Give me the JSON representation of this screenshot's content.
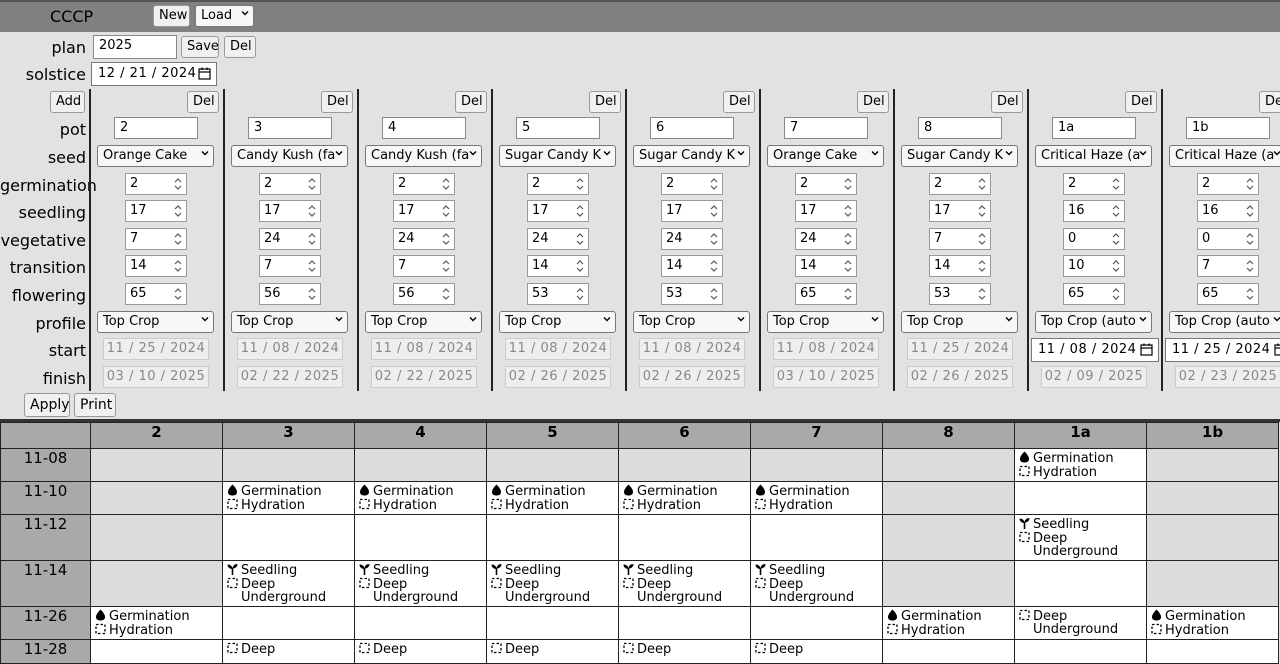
{
  "app": {
    "name": "CCCP",
    "new_label": "New",
    "load_label": "Load"
  },
  "plan": {
    "label": "plan",
    "value": "2025",
    "save_label": "Save",
    "del_label": "Del"
  },
  "solstice": {
    "label": "solstice",
    "value": "12 / 21 / 2024"
  },
  "add_label": "Add",
  "row_labels": {
    "pot": "pot",
    "seed": "seed",
    "germination": "germination",
    "seedling": "seedling",
    "vegetative": "vegetative",
    "transition": "transition",
    "flowering": "flowering",
    "profile": "profile",
    "start": "start",
    "finish": "finish"
  },
  "pots": [
    {
      "del": "Del",
      "pot": "2",
      "seed": "Orange Cake",
      "germination": "2",
      "seedling": "17",
      "vegetative": "7",
      "transition": "14",
      "flowering": "65",
      "profile": "Top Crop",
      "start": "11 / 25 / 2024",
      "finish": "03 / 10 / 2025"
    },
    {
      "del": "Del",
      "pot": "3",
      "seed": "Candy Kush (fa",
      "germination": "2",
      "seedling": "17",
      "vegetative": "24",
      "transition": "7",
      "flowering": "56",
      "profile": "Top Crop",
      "start": "11 / 08 / 2024",
      "finish": "02 / 22 / 2025"
    },
    {
      "del": "Del",
      "pot": "4",
      "seed": "Candy Kush (fa",
      "germination": "2",
      "seedling": "17",
      "vegetative": "24",
      "transition": "7",
      "flowering": "56",
      "profile": "Top Crop",
      "start": "11 / 08 / 2024",
      "finish": "02 / 22 / 2025"
    },
    {
      "del": "Del",
      "pot": "5",
      "seed": "Sugar Candy K",
      "germination": "2",
      "seedling": "17",
      "vegetative": "24",
      "transition": "14",
      "flowering": "53",
      "profile": "Top Crop",
      "start": "11 / 08 / 2024",
      "finish": "02 / 26 / 2025"
    },
    {
      "del": "Del",
      "pot": "6",
      "seed": "Sugar Candy K",
      "germination": "2",
      "seedling": "17",
      "vegetative": "24",
      "transition": "14",
      "flowering": "53",
      "profile": "Top Crop",
      "start": "11 / 08 / 2024",
      "finish": "02 / 26 / 2025"
    },
    {
      "del": "Del",
      "pot": "7",
      "seed": "Orange Cake",
      "germination": "2",
      "seedling": "17",
      "vegetative": "24",
      "transition": "14",
      "flowering": "65",
      "profile": "Top Crop",
      "start": "11 / 08 / 2024",
      "finish": "03 / 10 / 2025"
    },
    {
      "del": "Del",
      "pot": "8",
      "seed": "Sugar Candy K",
      "germination": "2",
      "seedling": "17",
      "vegetative": "7",
      "transition": "14",
      "flowering": "53",
      "profile": "Top Crop",
      "start": "11 / 25 / 2024",
      "finish": "02 / 26 / 2025"
    },
    {
      "del": "Del",
      "pot": "1a",
      "seed": "Critical Haze (a",
      "germination": "2",
      "seedling": "16",
      "vegetative": "0",
      "transition": "10",
      "flowering": "65",
      "profile": "Top Crop (auto",
      "start": "11 / 08 / 2024",
      "finish": "02 / 09 / 2025"
    },
    {
      "del": "Del",
      "pot": "1b",
      "seed": "Critical Haze (a",
      "germination": "2",
      "seedling": "16",
      "vegetative": "0",
      "transition": "7",
      "flowering": "65",
      "profile": "Top Crop (auto",
      "start": "11 / 25 / 2024",
      "finish": "02 / 23 / 2025"
    }
  ],
  "apply_label": "Apply",
  "print_label": "Print",
  "grid": {
    "columns": [
      "2",
      "3",
      "4",
      "5",
      "6",
      "7",
      "8",
      "1a",
      "1b"
    ],
    "rows": [
      {
        "date": "11-08",
        "cells": [
          null,
          null,
          null,
          null,
          null,
          null,
          null,
          [
            {
              "icon": "seed",
              "text": "Germination"
            },
            {
              "icon": "box",
              "text": "Hydration"
            }
          ],
          null
        ]
      },
      {
        "date": "11-10",
        "cells": [
          null,
          [
            {
              "icon": "seed",
              "text": "Germination"
            },
            {
              "icon": "box",
              "text": "Hydration"
            }
          ],
          [
            {
              "icon": "seed",
              "text": "Germination"
            },
            {
              "icon": "box",
              "text": "Hydration"
            }
          ],
          [
            {
              "icon": "seed",
              "text": "Germination"
            },
            {
              "icon": "box",
              "text": "Hydration"
            }
          ],
          [
            {
              "icon": "seed",
              "text": "Germination"
            },
            {
              "icon": "box",
              "text": "Hydration"
            }
          ],
          [
            {
              "icon": "seed",
              "text": "Germination"
            },
            {
              "icon": "box",
              "text": "Hydration"
            }
          ],
          null,
          [],
          null
        ]
      },
      {
        "date": "11-12",
        "cells": [
          null,
          [],
          [],
          [],
          [],
          [],
          null,
          [
            {
              "icon": "sprout",
              "text": "Seedling"
            },
            {
              "icon": "box",
              "text": "Deep"
            },
            {
              "icon": "none",
              "text": "Underground"
            }
          ],
          null
        ]
      },
      {
        "date": "11-14",
        "cells": [
          null,
          [
            {
              "icon": "sprout",
              "text": "Seedling"
            },
            {
              "icon": "box",
              "text": "Deep"
            },
            {
              "icon": "none",
              "text": "Underground"
            }
          ],
          [
            {
              "icon": "sprout",
              "text": "Seedling"
            },
            {
              "icon": "box",
              "text": "Deep"
            },
            {
              "icon": "none",
              "text": "Underground"
            }
          ],
          [
            {
              "icon": "sprout",
              "text": "Seedling"
            },
            {
              "icon": "box",
              "text": "Deep"
            },
            {
              "icon": "none",
              "text": "Underground"
            }
          ],
          [
            {
              "icon": "sprout",
              "text": "Seedling"
            },
            {
              "icon": "box",
              "text": "Deep"
            },
            {
              "icon": "none",
              "text": "Underground"
            }
          ],
          [
            {
              "icon": "sprout",
              "text": "Seedling"
            },
            {
              "icon": "box",
              "text": "Deep"
            },
            {
              "icon": "none",
              "text": "Underground"
            }
          ],
          null,
          [],
          null
        ]
      },
      {
        "date": "11-26",
        "cells": [
          [
            {
              "icon": "seed",
              "text": "Germination"
            },
            {
              "icon": "box",
              "text": "Hydration"
            }
          ],
          [],
          [],
          [],
          [],
          [],
          [
            {
              "icon": "seed",
              "text": "Germination"
            },
            {
              "icon": "box",
              "text": "Hydration"
            }
          ],
          [
            {
              "icon": "box",
              "text": "Deep"
            },
            {
              "icon": "none",
              "text": "Underground"
            }
          ],
          [
            {
              "icon": "seed",
              "text": "Germination"
            },
            {
              "icon": "box",
              "text": "Hydration"
            }
          ]
        ]
      },
      {
        "date": "11-28",
        "cells": [
          [],
          [
            {
              "icon": "box",
              "text": "Deep"
            }
          ],
          [
            {
              "icon": "box",
              "text": "Deep"
            }
          ],
          [
            {
              "icon": "box",
              "text": "Deep"
            }
          ],
          [
            {
              "icon": "box",
              "text": "Deep"
            }
          ],
          [
            {
              "icon": "box",
              "text": "Deep"
            }
          ],
          [],
          [],
          []
        ]
      }
    ]
  }
}
